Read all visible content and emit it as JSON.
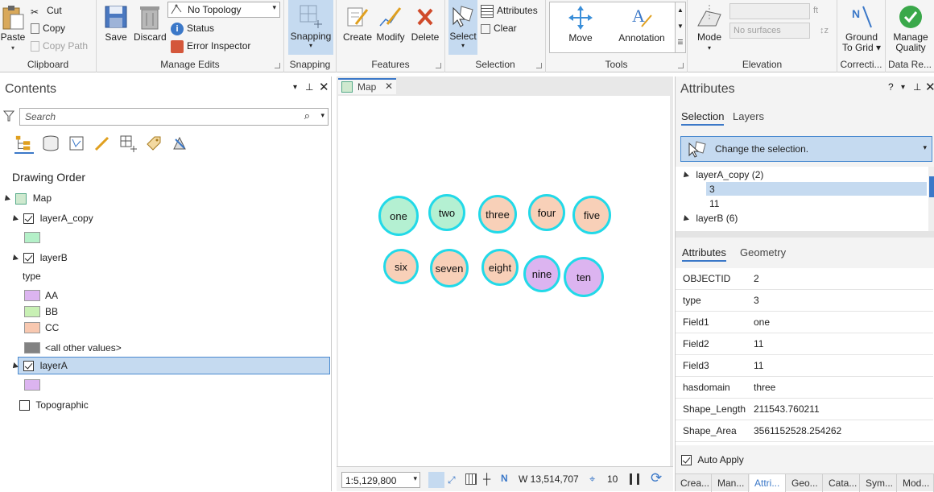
{
  "ribbon": {
    "clipboard": {
      "label": "Clipboard",
      "paste": "Paste",
      "cut": "Cut",
      "copy": "Copy",
      "copy_path": "Copy Path"
    },
    "manage_edits": {
      "label": "Manage Edits",
      "save": "Save",
      "discard": "Discard",
      "topology_value": "No Topology",
      "status": "Status",
      "error_inspector": "Error Inspector"
    },
    "snapping": {
      "label": "Snapping",
      "button": "Snapping"
    },
    "features": {
      "label": "Features",
      "create": "Create",
      "modify": "Modify",
      "delete": "Delete"
    },
    "selection": {
      "label": "Selection",
      "select": "Select",
      "attributes": "Attributes",
      "clear": "Clear"
    },
    "tools": {
      "label": "Tools",
      "move": "Move",
      "annotation": "Annotation"
    },
    "elevation": {
      "label": "Elevation",
      "mode": "Mode",
      "ft": "ft",
      "surfaces_placeholder": "No surfaces"
    },
    "corrections": {
      "label": "Correcti...",
      "ground_to_grid_1": "Ground",
      "ground_to_grid_2": "To Grid"
    },
    "data_reviewer": {
      "label": "Data Re...",
      "manage_quality_1": "Manage",
      "manage_quality_2": "Quality"
    }
  },
  "contents": {
    "title": "Contents",
    "search_placeholder": "Search",
    "section": "Drawing Order",
    "map": "Map",
    "layerA_copy": "layerA_copy",
    "layerB": "layerB",
    "type_label": "type",
    "legend": [
      {
        "label": "AA",
        "color": "#dcb4f0"
      },
      {
        "label": "BB",
        "color": "#c8f0b4"
      },
      {
        "label": "CC",
        "color": "#f8c8b0"
      },
      {
        "label": "<all other values>",
        "color": "#828282"
      }
    ],
    "layerA_copy_color": "#b4f0c8",
    "layerA": "layerA",
    "layerA_color": "#dcb4f0",
    "topographic": "Topographic"
  },
  "map": {
    "tab": "Map",
    "features": [
      {
        "label": "one",
        "fill": "#b4f0d2"
      },
      {
        "label": "two",
        "fill": "#b4f0d2"
      },
      {
        "label": "three",
        "fill": "#f8d0b8"
      },
      {
        "label": "four",
        "fill": "#f8d0b8"
      },
      {
        "label": "five",
        "fill": "#f8d0b8"
      },
      {
        "label": "six",
        "fill": "#f8d0b8"
      },
      {
        "label": "seven",
        "fill": "#f8d0b8"
      },
      {
        "label": "eight",
        "fill": "#f8d0b8"
      },
      {
        "label": "nine",
        "fill": "#dcb4f0"
      },
      {
        "label": "ten",
        "fill": "#dcb4f0"
      }
    ],
    "scale": "1:5,129,800",
    "coords": "W 13,514,707",
    "selected_count": "10"
  },
  "attributes": {
    "title": "Attributes",
    "help": "?",
    "tabs": {
      "selection": "Selection",
      "layers": "Layers"
    },
    "change_selection": "Change the selection.",
    "tree": [
      {
        "label": "layerA_copy (2)",
        "children": [
          "3",
          "11"
        ]
      },
      {
        "label": "layerB (6)",
        "children": []
      }
    ],
    "subtabs": {
      "attributes": "Attributes",
      "geometry": "Geometry"
    },
    "fields": [
      {
        "k": "OBJECTID",
        "v": "2"
      },
      {
        "k": "type",
        "v": "3"
      },
      {
        "k": "Field1",
        "v": "one"
      },
      {
        "k": "Field2",
        "v": "11"
      },
      {
        "k": "Field3",
        "v": "11"
      },
      {
        "k": "hasdomain",
        "v": "three"
      },
      {
        "k": "Shape_Length",
        "v": "211543.760211"
      },
      {
        "k": "Shape_Area",
        "v": "3561152528.254262"
      }
    ],
    "auto_apply": "Auto Apply"
  },
  "bottom_tabs": [
    "Crea...",
    "Man...",
    "Attri...",
    "Geo...",
    "Cata...",
    "Sym...",
    "Mod..."
  ]
}
